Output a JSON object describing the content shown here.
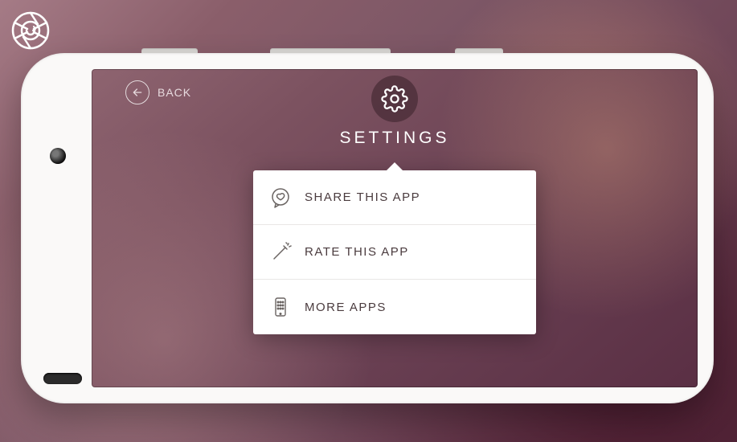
{
  "back": {
    "label": "BACK"
  },
  "header": {
    "title": "SETTINGS"
  },
  "menu": {
    "items": [
      {
        "label": "SHARE THIS APP",
        "icon": "heart-speech-icon"
      },
      {
        "label": "RATE THIS APP",
        "icon": "wand-icon"
      },
      {
        "label": "MORE APPS",
        "icon": "phone-grid-icon"
      }
    ]
  },
  "watermark": {
    "icon": "aperture-refresh-icon"
  },
  "colors": {
    "panel_bg": "#ffffff",
    "text": "#4a3b3e",
    "icon": "#6a6462",
    "overlay_accent": "#3e252d"
  }
}
